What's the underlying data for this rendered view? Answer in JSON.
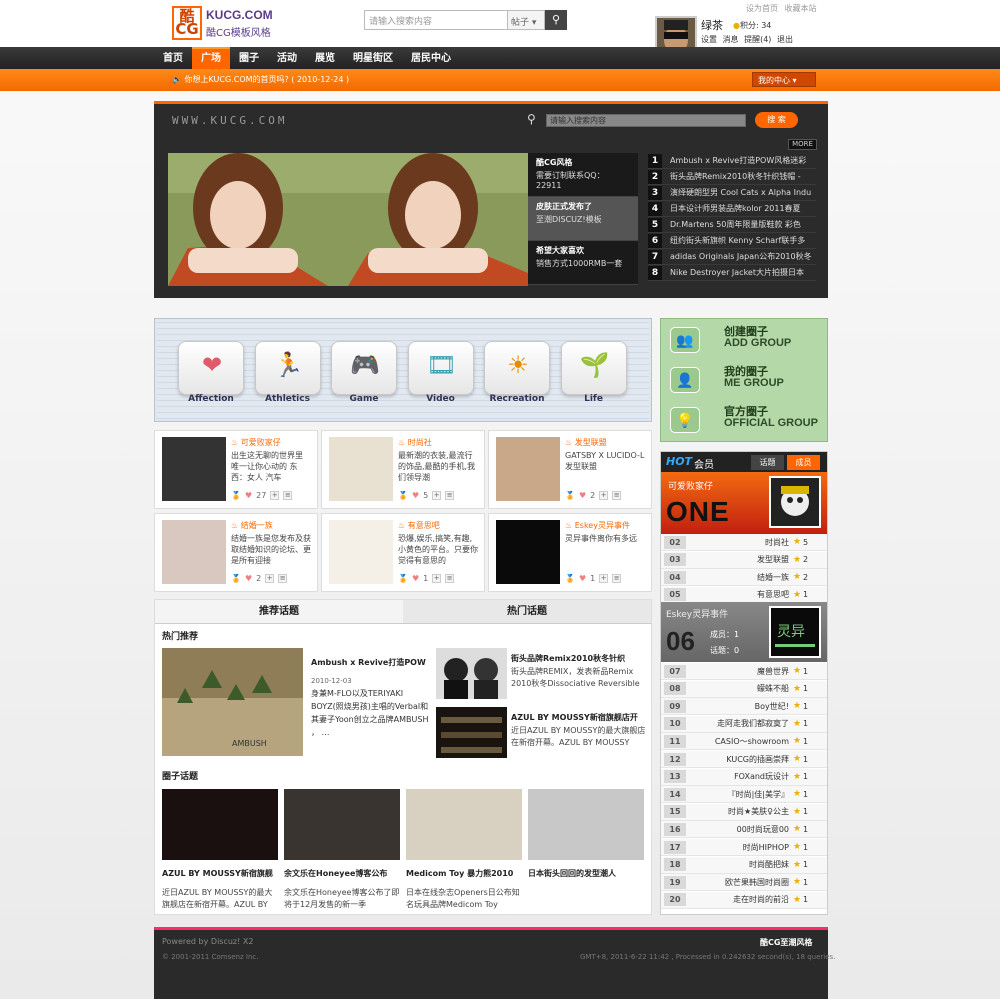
{
  "header": {
    "logo_mark": "酷CG",
    "logo_text": "KUCG.COM",
    "logo_sub": "酷CG模板风格",
    "search_placeholder": "请输入搜索内容",
    "search_type": "帖子",
    "top_links": "设为首页 收藏本站",
    "username": "绿茶",
    "score": "积分: 34",
    "user_links": "设置 消息 提醒(4) 退出"
  },
  "nav": {
    "items": [
      "首页",
      "广场",
      "圈子",
      "活动",
      "展览",
      "明星街区",
      "居民中心"
    ],
    "active": "广场"
  },
  "notice": {
    "text": "你想上KUCG.COM的首页吗? ( 2010-12-24 )",
    "center_button": "我的中心"
  },
  "banner": {
    "site": "WWW.KUCG.COM",
    "search_placeholder": "请输入搜索内容",
    "search_button": "搜 索",
    "more": "MORE",
    "side": [
      {
        "title": "酷CG风格",
        "desc": "需要订制联系QQ：22911"
      },
      {
        "title": "皮肤正式发布了",
        "desc": "至潮DISCUZ!模板"
      },
      {
        "title": "希望大家喜欢",
        "desc": "销售方式1000RMB一套"
      }
    ],
    "rank": [
      "Ambush x Revive打造POW风格迷彩",
      "街头品牌Remix2010秋冬针织钱帽 -",
      "演绎硬朗型男 Cool Cats x Alpha Indu",
      "日本设计师男装品牌kolor 2011春夏",
      "Dr.Martens 50周年限量版鞋款 彩色",
      "纽约街头新旗帜 Kenny Scharf联手多",
      "adidas Originals Japan公布2010秋冬",
      "Nike Destroyer Jacket大片拍摄日本"
    ]
  },
  "categories": [
    "Affection",
    "Athletics",
    "Game",
    "Video",
    "Recreation",
    "Life"
  ],
  "groups": [
    {
      "cn": "创建圈子",
      "en": "ADD GROUP"
    },
    {
      "cn": "我的圈子",
      "en": "ME GROUP"
    },
    {
      "cn": "官方圈子",
      "en": "OFFICIAL GROUP"
    }
  ],
  "cards": [
    {
      "name": "可爱败家仔",
      "desc": "出生这无聊的世界里 唯一让你心动的 东西：女人 汽车",
      "count": "27"
    },
    {
      "name": "时尚社",
      "desc": "最新潮的衣装,最流行的饰品,最酷的手机,我们领导潮",
      "count": "5"
    },
    {
      "name": "发型联盟",
      "desc": "GATSBY X LUCIDO-L 发型联盟",
      "count": "2"
    },
    {
      "name": "结婚一族",
      "desc": "结婚一族是您发布及获取结婚知识的论坛、更是所有迎接",
      "count": "2"
    },
    {
      "name": "有意思吧",
      "desc": "恐爆,娱乐,搞笑,有趣,小黄色的平台。只要你觉得有意思的",
      "count": "1"
    },
    {
      "name": "Eskey灵异事件",
      "desc": "灵异事件离你有多远",
      "count": "1"
    }
  ],
  "topics": {
    "tab1": "推荐话题",
    "tab2": "热门话题",
    "hot_title": "热门推荐",
    "feature": {
      "title": "Ambush x Revive打造POW",
      "date": "2010-12-03",
      "desc": "身兼M-FLO以及TERIYAKI BOYZ(照烧男孩)主唱的Verbal和其妻子Yoon创立之品牌AMBUSH ， …"
    },
    "small": [
      {
        "title": "街头品牌Remix2010秋冬针织",
        "desc": "街头品牌REMIX，发表新品Remix 2010秋冬Dissociative Reversible"
      },
      {
        "title": "AZUL BY MOUSSY新宿旗舰店开",
        "desc": "近日AZUL BY MOUSSY的最大旗舰店在新宿开幕。AZUL BY MOUSSY"
      }
    ],
    "circle_title": "圈子话题",
    "thumbs": [
      {
        "title": "AZUL BY MOUSSY新宿旗舰",
        "desc": "近日AZUL BY MOUSSY的最大旗舰店在新宿开幕。AZUL BY"
      },
      {
        "title": "余文乐在Honeyee博客公布",
        "desc": "余文乐在Honeyee博客公布了即将于12月发售的新一季"
      },
      {
        "title": "Medicom Toy 暴力熊2010",
        "desc": "日本在线杂志Openers日公布知名玩具品牌Medicom Toy"
      },
      {
        "title": "日本街头回回的发型潮人",
        "desc": ""
      }
    ]
  },
  "hot": {
    "head1": "HOT",
    "head2": "会员",
    "tab1": "话题",
    "tab2": "成员",
    "one_name": "可爱败家仔",
    "one_big": "ONE",
    "rows_a": [
      {
        "no": "02",
        "name": "时尚社",
        "count": "5"
      },
      {
        "no": "03",
        "name": "发型联盟",
        "count": "2"
      },
      {
        "no": "04",
        "name": "结婚一族",
        "count": "2"
      },
      {
        "no": "05",
        "name": "有意思吧",
        "count": "1"
      }
    ],
    "six_name": "Eskey灵异事件",
    "six_big": "06",
    "six_members": "成员：1",
    "six_topics": "话题：0",
    "rows_b": [
      {
        "no": "07",
        "name": "魔兽世界",
        "count": "1"
      },
      {
        "no": "08",
        "name": "蠓蛛不船",
        "count": "1"
      },
      {
        "no": "09",
        "name": "Boy世纪!",
        "count": "1"
      },
      {
        "no": "10",
        "name": "走阿走我们都寂寞了",
        "count": "1"
      },
      {
        "no": "11",
        "name": "CASIO～showroom",
        "count": "1"
      },
      {
        "no": "12",
        "name": "KUCG的插画崇拜",
        "count": "1"
      },
      {
        "no": "13",
        "name": "FOXand玩设计",
        "count": "1"
      },
      {
        "no": "14",
        "name": "『时尚|佳|美学』",
        "count": "1"
      },
      {
        "no": "15",
        "name": "时尚★美肤♀公主",
        "count": "1"
      },
      {
        "no": "16",
        "name": "00时尚玩意00",
        "count": "1"
      },
      {
        "no": "17",
        "name": "时尚HIPHOP",
        "count": "1"
      },
      {
        "no": "18",
        "name": "时尚酷把妹",
        "count": "1"
      },
      {
        "no": "19",
        "name": "欧芒果韩国时尚圈",
        "count": "1"
      },
      {
        "no": "20",
        "name": "走在时尚的前沿",
        "count": "1"
      }
    ]
  },
  "footer": {
    "powered": "Powered by Discuz! X2",
    "copyright": "© 2001-2011 Comsenz Inc.",
    "brand": "酷CG至潮风格",
    "stats": "GMT+8, 2011-6-22 11:42 , Processed in 0.242632 second(s), 18 queries."
  }
}
